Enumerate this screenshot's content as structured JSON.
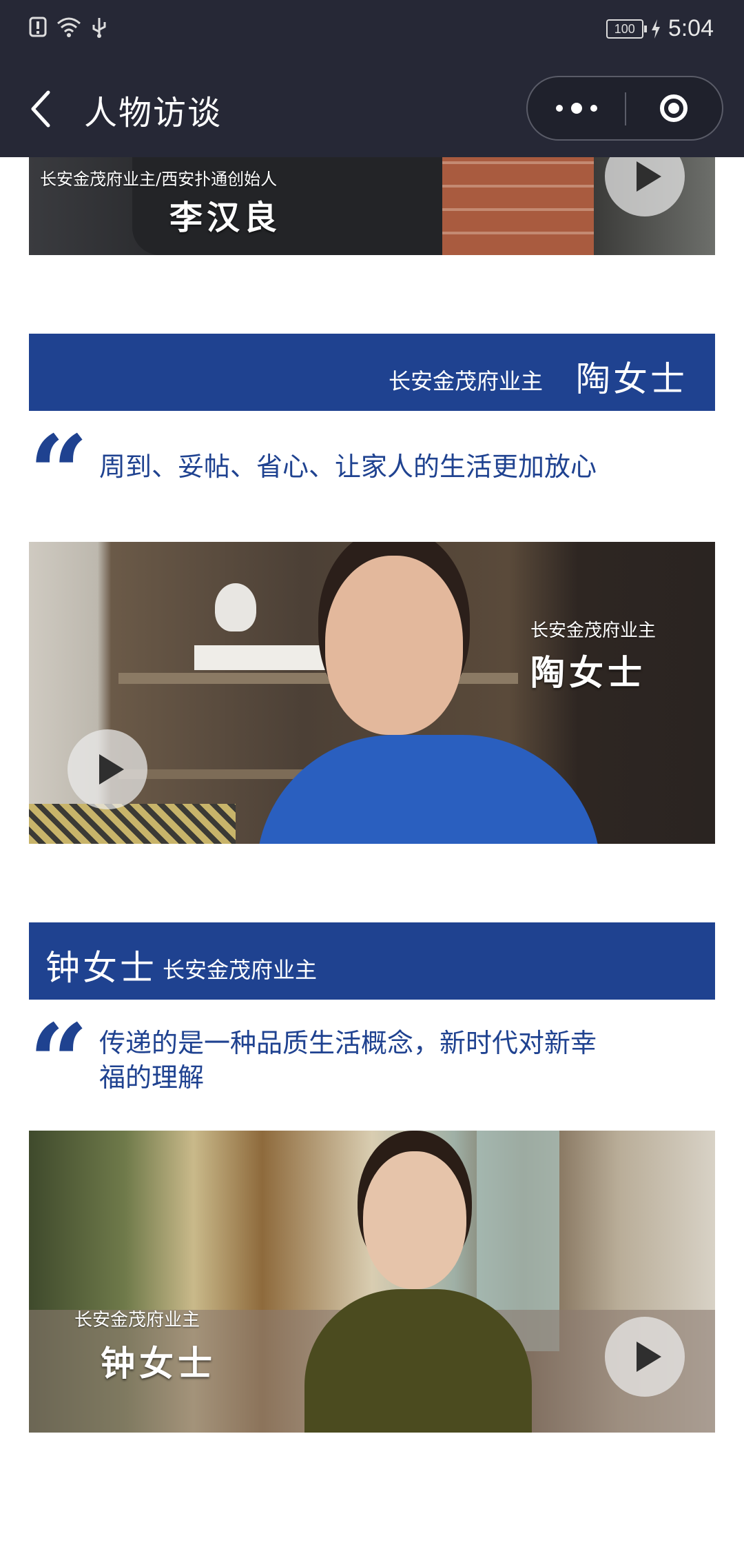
{
  "status_bar": {
    "battery": "100",
    "time": "5:04"
  },
  "nav": {
    "title": "人物访谈"
  },
  "interviews": [
    {
      "overlay_sub": "长安金茂府业主/西安扑通创始人",
      "overlay_name": "李汉良"
    },
    {
      "banner_sub": "长安金茂府业主",
      "banner_name": "陶女士",
      "quote": "周到、妥帖、省心、让家人的生活更加放心",
      "overlay_sub": "长安金茂府业主",
      "overlay_name": "陶女士"
    },
    {
      "banner_name": "钟女士",
      "banner_sub": "长安金茂府业主",
      "quote_line1": "传递的是一种品质生活概念，新时代对新幸",
      "quote_line2": "福的理解",
      "overlay_sub": "长安金茂府业主",
      "overlay_name": "钟女士"
    }
  ],
  "icons": {
    "quote": "“"
  }
}
